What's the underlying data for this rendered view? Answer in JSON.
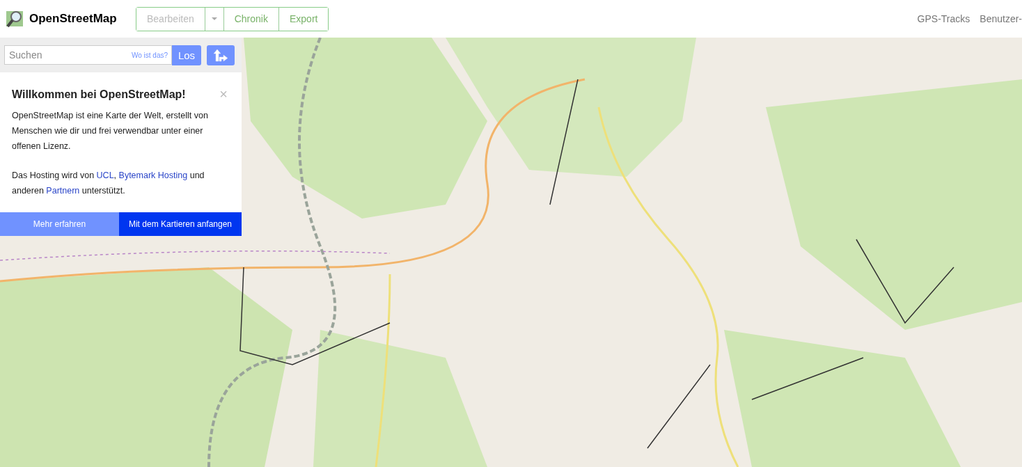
{
  "header": {
    "logo": "OpenStreetMap",
    "edit_buttons": [
      {
        "label": "Bearbeiten",
        "kind": "main",
        "disabled": true
      },
      {
        "kind": "dropdown"
      },
      {
        "label": "Chronik",
        "kind": "main",
        "disabled": false
      },
      {
        "label": "Export",
        "kind": "main",
        "disabled": false
      }
    ],
    "nav_links": [
      "GPS-Tracks",
      "Benutzer-"
    ]
  },
  "search": {
    "placeholder": "Suchen",
    "where_link": "Wo ist das?",
    "go_button": "Los"
  },
  "welcome": {
    "title": "Willkommen bei OpenStreetMap!",
    "close": "×",
    "paragraphs": [
      [
        {
          "kind": "text",
          "text": "OpenStreetMap ist eine Karte der Welt, erstellt von Menschen wie dir und frei verwendbar unter einer offenen Lizenz."
        }
      ],
      [
        {
          "kind": "text",
          "text": "Das Hosting wird von "
        },
        {
          "kind": "link",
          "text": "UCL"
        },
        {
          "kind": "text",
          "text": ", "
        },
        {
          "kind": "link",
          "text": "Bytemark Hosting"
        },
        {
          "kind": "text",
          "text": " und anderen "
        },
        {
          "kind": "link",
          "text": "Partnern"
        },
        {
          "kind": "text",
          "text": " unterstützt."
        }
      ]
    ],
    "buttons": [
      {
        "label": "Mehr erfahren",
        "kind": "secondary"
      },
      {
        "label": "Mit dem Kartieren anfangen",
        "kind": "primary"
      }
    ]
  }
}
